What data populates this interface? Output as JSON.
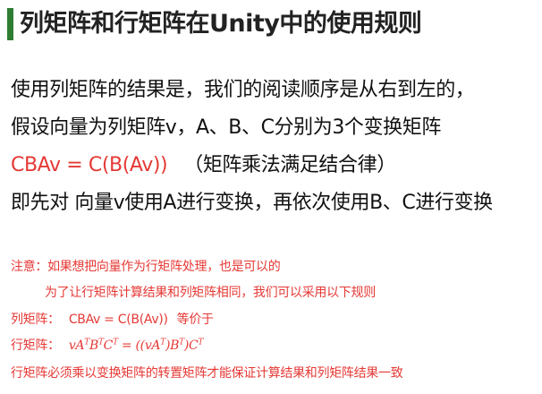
{
  "title": "列矩阵和行矩阵在Unity中的使用规则",
  "lines": {
    "l1": "使用列矩阵的结果是，我们的阅读顺序是从右到左的，",
    "l2": "假设向量为列矩阵v，A、B、C分别为3个变换矩阵",
    "l3_formula": "CBAv = C(B(Av))",
    "l3_rest": "（矩阵乘法满足结合律）",
    "l4": "即先对 向量v使用A进行变换，再依次使用B、C进行变换"
  },
  "notes": {
    "n1": "注意：如果想把向量作为行矩阵处理，也是可以的",
    "n2": "为了让行矩阵计算结果和列矩阵相同，我们可以采用以下规则",
    "n3_label": "列矩阵：",
    "n3_formula": "CBAv = C(B(Av))",
    "n3_rest": "等价于",
    "n4_label": "行矩阵：",
    "n4_formula_left": "vA",
    "n4_formula_b": "B",
    "n4_formula_c": "C",
    "n4_eq": " = ((vA",
    "n4_close1": ")B",
    "n4_close2": ")C",
    "sup": "T",
    "n5": "行矩阵必须乘以变换矩阵的转置矩阵才能保证计算结果和列矩阵结果一致"
  },
  "colors": {
    "accent_bar": "#2e7d32",
    "red": "#e53935",
    "text": "#111111"
  }
}
